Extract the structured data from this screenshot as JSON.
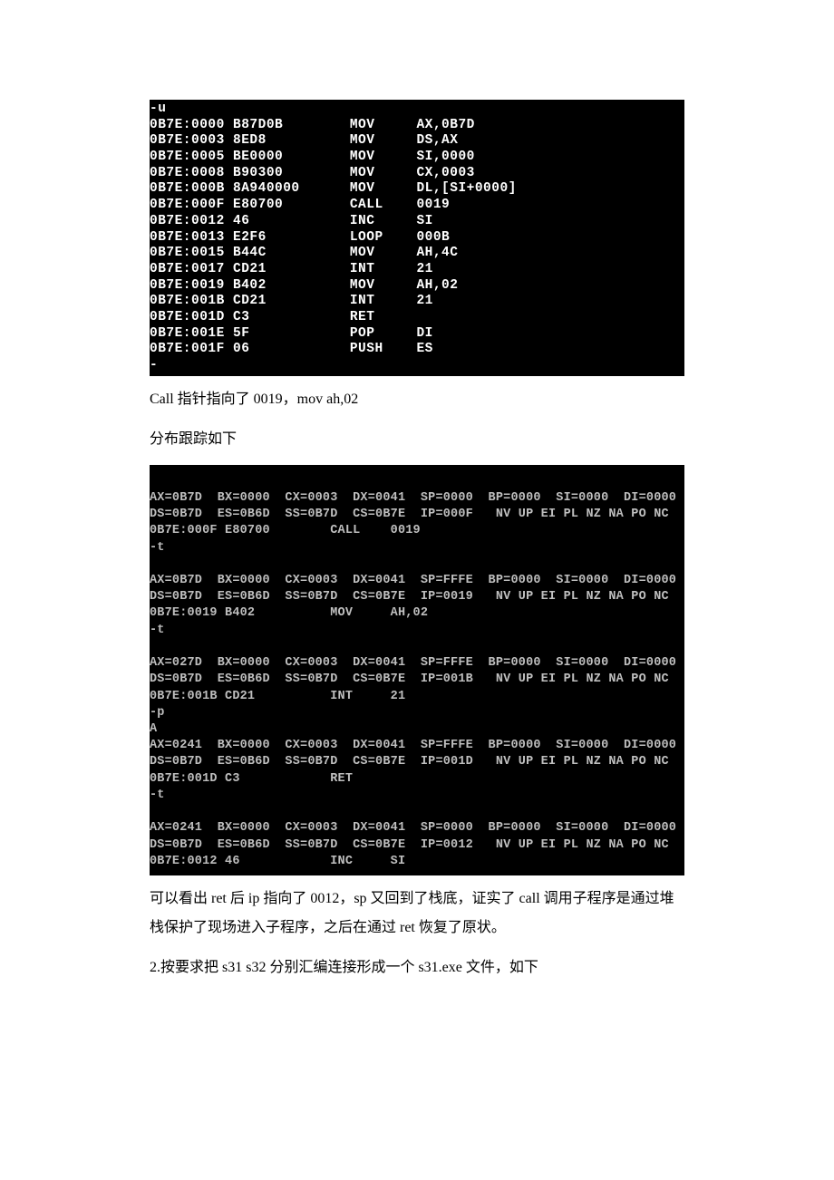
{
  "term1": {
    "lines": [
      "-u",
      "0B7E:0000 B87D0B        MOV     AX,0B7D",
      "0B7E:0003 8ED8          MOV     DS,AX",
      "0B7E:0005 BE0000        MOV     SI,0000",
      "0B7E:0008 B90300        MOV     CX,0003",
      "0B7E:000B 8A940000      MOV     DL,[SI+0000]",
      "0B7E:000F E80700        CALL    0019",
      "0B7E:0012 46            INC     SI",
      "0B7E:0013 E2F6          LOOP    000B",
      "0B7E:0015 B44C          MOV     AH,4C",
      "0B7E:0017 CD21          INT     21",
      "0B7E:0019 B402          MOV     AH,02",
      "0B7E:001B CD21          INT     21",
      "0B7E:001D C3            RET",
      "0B7E:001E 5F            POP     DI",
      "0B7E:001F 06            PUSH    ES",
      "-"
    ]
  },
  "para1": "Call 指针指向了 0019，mov ah,02",
  "para2": "分布跟踪如下",
  "term2": {
    "lines": [
      "",
      "AX=0B7D  BX=0000  CX=0003  DX=0041  SP=0000  BP=0000  SI=0000  DI=0000",
      "DS=0B7D  ES=0B6D  SS=0B7D  CS=0B7E  IP=000F   NV UP EI PL NZ NA PO NC",
      "0B7E:000F E80700        CALL    0019",
      "-t",
      "",
      "AX=0B7D  BX=0000  CX=0003  DX=0041  SP=FFFE  BP=0000  SI=0000  DI=0000",
      "DS=0B7D  ES=0B6D  SS=0B7D  CS=0B7E  IP=0019   NV UP EI PL NZ NA PO NC",
      "0B7E:0019 B402          MOV     AH,02",
      "-t",
      "",
      "AX=027D  BX=0000  CX=0003  DX=0041  SP=FFFE  BP=0000  SI=0000  DI=0000",
      "DS=0B7D  ES=0B6D  SS=0B7D  CS=0B7E  IP=001B   NV UP EI PL NZ NA PO NC",
      "0B7E:001B CD21          INT     21",
      "-p",
      "A",
      "AX=0241  BX=0000  CX=0003  DX=0041  SP=FFFE  BP=0000  SI=0000  DI=0000",
      "DS=0B7D  ES=0B6D  SS=0B7D  CS=0B7E  IP=001D   NV UP EI PL NZ NA PO NC",
      "0B7E:001D C3            RET",
      "-t",
      "",
      "AX=0241  BX=0000  CX=0003  DX=0041  SP=0000  BP=0000  SI=0000  DI=0000",
      "DS=0B7D  ES=0B6D  SS=0B7D  CS=0B7E  IP=0012   NV UP EI PL NZ NA PO NC",
      "0B7E:0012 46            INC     SI"
    ]
  },
  "para3": "可以看出 ret 后 ip 指向了 0012，sp 又回到了栈底，证实了 call 调用子程序是通过堆栈保护了现场进入子程序，之后在通过 ret 恢复了原状。",
  "para4": "2.按要求把 s31 s32  分别汇编连接形成一个 s31.exe 文件，如下"
}
